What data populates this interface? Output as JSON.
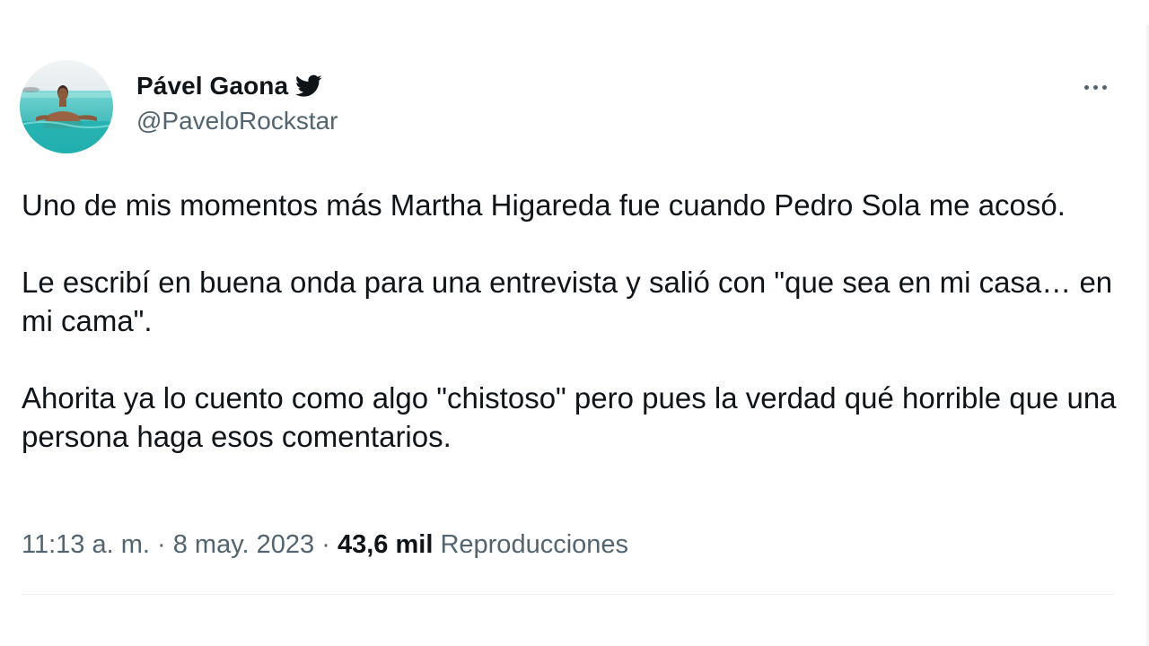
{
  "author": {
    "display_name": "Pável Gaona",
    "handle": "@PaveloRockstar",
    "avatar_icon": "profile-photo-swimmer",
    "verified_icon": "twitter-bird-icon"
  },
  "tweet": {
    "paragraphs": [
      "Uno de mis momentos más Martha Higareda fue cuando Pedro Sola me acosó.",
      "Le escribí en buena onda para una entrevista y salió con \"que sea en mi casa… en mi cama\".",
      "Ahorita ya lo cuento como algo \"chistoso\" pero pues la verdad qué horrible que una persona haga esos comentarios."
    ]
  },
  "meta": {
    "time": "11:13 a. m.",
    "separator": "·",
    "date": "8 may. 2023",
    "views_count": "43,6 mil",
    "views_label": "Reproducciones"
  },
  "colors": {
    "text_primary": "#0f1419",
    "text_secondary": "#536471",
    "divider": "#eff3f4",
    "background": "#ffffff"
  }
}
